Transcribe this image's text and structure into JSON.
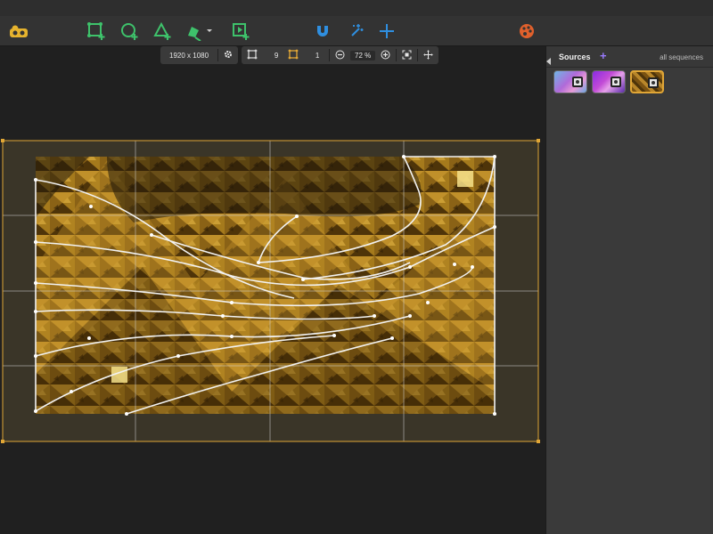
{
  "toolbar": {
    "tools": [
      {
        "name": "logo-icon",
        "color": "#e6b32e"
      },
      {
        "name": "add-quad-icon",
        "color": "#3ec26b"
      },
      {
        "name": "add-circle-icon",
        "color": "#3ec26b"
      },
      {
        "name": "add-triangle-icon",
        "color": "#3ec26b"
      },
      {
        "name": "pen-tool-icon",
        "color": "#3ec26b"
      },
      {
        "name": "add-video-surface-icon",
        "color": "#3ec26b"
      },
      {
        "name": "magnet-icon",
        "color": "#2f8fe0"
      },
      {
        "name": "magic-wand-icon",
        "color": "#2f8fe0"
      },
      {
        "name": "crosshair-icon",
        "color": "#2f8fe0"
      },
      {
        "name": "palette-icon",
        "color": "#e0602c"
      }
    ]
  },
  "subtoolbar": {
    "resolution": "1920 x 1080",
    "grid_columns": "9",
    "grid_rows": "1",
    "zoom": "72 %"
  },
  "canvas": {
    "selection_color": "#e0a636",
    "grid_color": "#cfcfcf"
  },
  "sources": {
    "title": "Sources",
    "add_label": "+",
    "filter_label": "all sequences",
    "items": [
      {
        "name": "source-thumb-1",
        "selected": false
      },
      {
        "name": "source-thumb-2",
        "selected": false
      },
      {
        "name": "source-thumb-3",
        "selected": true
      }
    ]
  }
}
